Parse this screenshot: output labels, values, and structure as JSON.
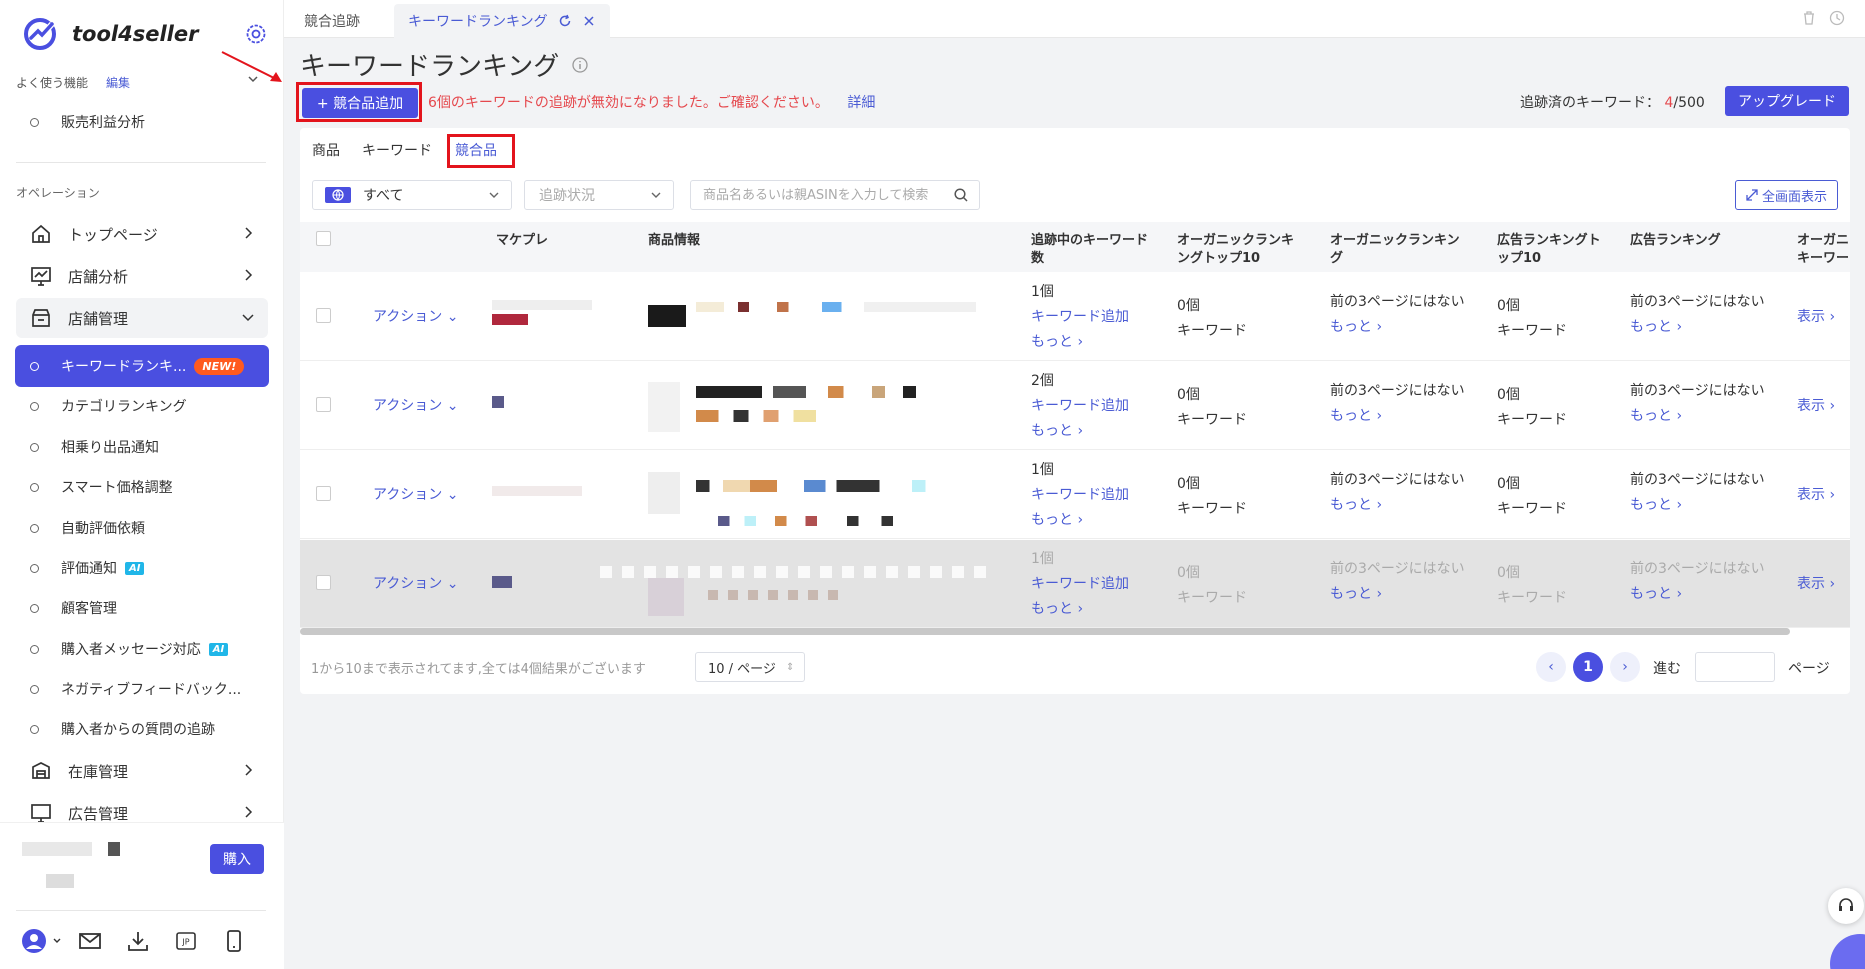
{
  "brand": {
    "name": "tool4seller"
  },
  "sidebar": {
    "favorites_label": "よく使う機能",
    "favorites_edit": "編集",
    "favorite_items": [
      "販売利益分析"
    ],
    "section_label": "オペレーション",
    "menu": [
      {
        "label": "トップページ",
        "icon": "home-icon"
      },
      {
        "label": "店舗分析",
        "icon": "chart-icon"
      },
      {
        "label": "店舗管理",
        "icon": "store-icon"
      }
    ],
    "submenu": [
      {
        "label": "キーワードランキ...",
        "badge": "NEW!",
        "active": true
      },
      {
        "label": "カテゴリランキング"
      },
      {
        "label": "相乗り出品通知"
      },
      {
        "label": "スマート価格調整"
      },
      {
        "label": "自動評価依頼"
      },
      {
        "label": "評価通知",
        "badge": "AI"
      },
      {
        "label": "顧客管理"
      },
      {
        "label": "購入者メッセージ対応",
        "badge": "AI"
      },
      {
        "label": "ネガティブフィードバック..."
      },
      {
        "label": "購入者からの質問の追跡"
      }
    ],
    "menu_after": [
      {
        "label": "在庫管理",
        "icon": "inventory-icon"
      },
      {
        "label": "広告管理",
        "icon": "monitor-icon"
      }
    ],
    "buy_label": "購入",
    "bottom_icons": [
      "user-icon",
      "mail-icon",
      "download-icon",
      "jp-icon",
      "mobile-icon"
    ],
    "jp_label": "JP"
  },
  "tabs": [
    {
      "label": "競合追跡"
    },
    {
      "label": "キーワードランキング",
      "active": true
    }
  ],
  "page": {
    "title": "キーワードランキング",
    "add_button": "+ 競合品追加",
    "notice": "6個のキーワードの追跡が無効になりました。ご確認ください。",
    "notice_link": "詳細",
    "tracked_label": "追跡済のキーワード：",
    "tracked_count": "4",
    "tracked_total": "/500",
    "upgrade_button": "アップグレード"
  },
  "subtabs": [
    {
      "label": "商品"
    },
    {
      "label": "キーワード"
    },
    {
      "label": "競合品",
      "active": true
    }
  ],
  "filters": {
    "marketplace": "すべて",
    "status_placeholder": "追跡状況",
    "search_placeholder": "商品名あるいは親ASINを入力して検索",
    "fullscreen": "全画面表示"
  },
  "table": {
    "headers": {
      "marketplace": "マケプレ",
      "product": "商品情報",
      "tracking_kw_1": "追跡中のキーワード",
      "tracking_kw_2": "数",
      "org_top10_1": "オーガニックランキ",
      "org_top10_2": "ングトップ10",
      "org_rank_1": "オーガニックランキン",
      "org_rank_2": "グ",
      "ad_top10_1": "広告ランキングト",
      "ad_top10_2": "ップ10",
      "ad_rank": "広告ランキング",
      "org_kw_1": "オーガニ",
      "org_kw_2": "キーワー"
    },
    "action_label": "アクション",
    "add_kw_label": "キーワード追加",
    "more_label": "もっと",
    "keyword_unit": "キーワード",
    "not_in_top3": "前の3ページにはない",
    "show_label": "表示",
    "rows": [
      {
        "tracking": "1個",
        "org_top10": "0個",
        "ad_top10": "0個"
      },
      {
        "tracking": "2個",
        "org_top10": "0個",
        "ad_top10": "0個"
      },
      {
        "tracking": "1個",
        "org_top10": "0個",
        "ad_top10": "0個"
      },
      {
        "tracking": "1個",
        "org_top10": "0個",
        "ad_top10": "0個"
      }
    ]
  },
  "pagination": {
    "summary": "1から10まで表示されてます,全ては4個結果がございます",
    "page_size": "10 / ページ",
    "current": "1",
    "goto": "進む",
    "unit": "ページ"
  },
  "colors": {
    "accent": "#4a4fe0",
    "link": "#4a5bd4",
    "warning": "#e5484d",
    "highlight_box": "#e3141c"
  }
}
